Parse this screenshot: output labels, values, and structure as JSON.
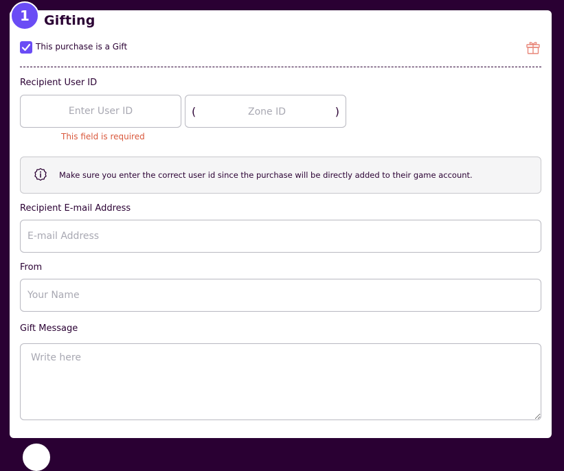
{
  "gifting": {
    "step_number": "1",
    "title": "Gifting",
    "is_gift_label": "This purchase is a Gift",
    "is_gift_checked": true,
    "recipient_user_id_label": "Recipient User ID",
    "user_id_placeholder": "Enter User ID",
    "zone_id_placeholder": "Zone ID",
    "zone_paren_open": "(",
    "zone_paren_close": ")",
    "required_error": "This field is required",
    "notice_text": "Make sure you enter the correct user id since the purchase will be directly added to their game account.",
    "email_label": "Recipient E-mail Address",
    "email_placeholder": "E-mail Address",
    "from_label": "From",
    "from_placeholder": "Your Name",
    "message_label": "Gift Message",
    "message_placeholder": "Write here"
  },
  "icons": {
    "gift": "gift-icon",
    "info": "info-icon",
    "check": "checkmark-icon"
  },
  "colors": {
    "background": "#2a0033",
    "accent": "#6a4cf5",
    "error": "#d9583c",
    "gift_icon": "#e8877a"
  }
}
